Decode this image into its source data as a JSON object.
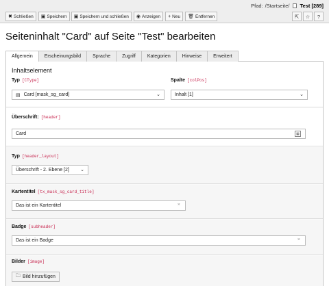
{
  "path": {
    "label": "Pfad:",
    "trail": "/Startseite/",
    "current": "Test [289]"
  },
  "toolbar": {
    "close": "Schließen",
    "save": "Speichern",
    "save_close": "Speichern und schließen",
    "view": "Anzeigen",
    "new": "Neu",
    "remove": "Entfernen"
  },
  "title": "Seiteninhalt \"Card\" auf Seite \"Test\" bearbeiten",
  "tabs": [
    {
      "label": "Allgemein",
      "active": true
    },
    {
      "label": "Erscheinungsbild"
    },
    {
      "label": "Sprache"
    },
    {
      "label": "Zugriff"
    },
    {
      "label": "Kategorien"
    },
    {
      "label": "Hinweise"
    },
    {
      "label": "Erweitert"
    }
  ],
  "content_element": {
    "heading": "Inhaltselement",
    "type_label": "Typ",
    "type_code": "[CType]",
    "type_value": "Card [mask_sg_card]",
    "column_label": "Spalte",
    "column_code": "[colPos]",
    "column_value": "Inhalt [1]"
  },
  "header": {
    "label": "Überschrift:",
    "code": "[header]",
    "value": "Card"
  },
  "header_layout": {
    "label": "Typ",
    "code": "[header_layout]",
    "value": "Überschrift - 2. Ebene [2]"
  },
  "card_title": {
    "label": "Kartentitel",
    "code": "[tx_mask_sg_card_title]",
    "value": "Das ist ein Kartentitel"
  },
  "badge": {
    "label": "Badge",
    "code": "[subheader]",
    "value": "Das ist ein Badge"
  },
  "images": {
    "label": "Bilder",
    "code": "[image]",
    "button": "Bild hinzufügen"
  }
}
